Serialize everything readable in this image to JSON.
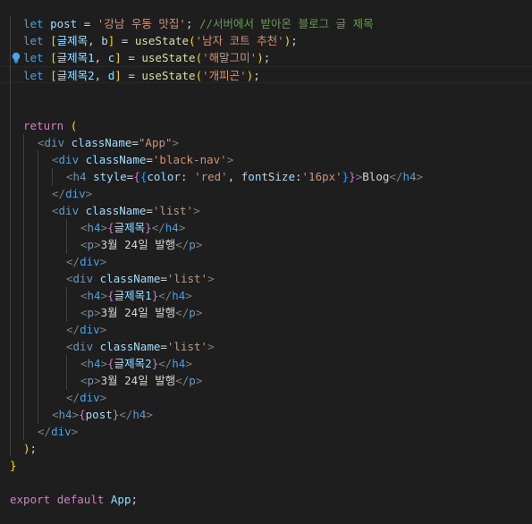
{
  "editor": {
    "lines": [
      {
        "parts": [
          [
            "kw",
            "let"
          ],
          [
            "pl",
            " "
          ],
          [
            "var",
            "post"
          ],
          [
            "pl",
            " = "
          ],
          [
            "str",
            "'강남 우동 맛집'"
          ],
          [
            "pl",
            "; "
          ],
          [
            "cmt",
            "//서버에서 받아온 블로그 글 제목"
          ]
        ]
      },
      {
        "parts": [
          [
            "kw",
            "let"
          ],
          [
            "pl",
            " "
          ],
          [
            "br1",
            "["
          ],
          [
            "var",
            "글제목"
          ],
          [
            "pl",
            ", "
          ],
          [
            "var",
            "b"
          ],
          [
            "br1",
            "]"
          ],
          [
            "pl",
            " = "
          ],
          [
            "fn",
            "useState"
          ],
          [
            "br1",
            "("
          ],
          [
            "str",
            "'남자 코트 추천'"
          ],
          [
            "br1",
            ")"
          ],
          [
            "pl",
            ";"
          ]
        ]
      },
      {
        "parts": [
          [
            "kw",
            "let"
          ],
          [
            "pl",
            " "
          ],
          [
            "br1",
            "["
          ],
          [
            "var",
            "글제목1"
          ],
          [
            "pl",
            ", "
          ],
          [
            "var",
            "c"
          ],
          [
            "br1",
            "]"
          ],
          [
            "pl",
            " = "
          ],
          [
            "fn",
            "useState"
          ],
          [
            "br1",
            "("
          ],
          [
            "str",
            "'해말그미'"
          ],
          [
            "br1",
            ")"
          ],
          [
            "pl",
            ";"
          ]
        ]
      },
      {
        "parts": [
          [
            "kw",
            "let"
          ],
          [
            "pl",
            " "
          ],
          [
            "br1",
            "["
          ],
          [
            "var",
            "글제목2"
          ],
          [
            "pl",
            ", "
          ],
          [
            "var",
            "d"
          ],
          [
            "br1",
            "]"
          ],
          [
            "pl",
            " = "
          ],
          [
            "fn",
            "useState"
          ],
          [
            "br1",
            "("
          ],
          [
            "str",
            "'개피곤'"
          ],
          [
            "br1",
            ")"
          ],
          [
            "pl",
            ";"
          ]
        ]
      },
      {
        "parts": []
      },
      {
        "parts": []
      },
      {
        "parts": [
          [
            "ret",
            "return"
          ],
          [
            "pl",
            " "
          ],
          [
            "br1",
            "("
          ]
        ]
      },
      {
        "parts": [
          [
            "ang",
            "<"
          ],
          [
            "tag",
            "div"
          ],
          [
            "pl",
            " "
          ],
          [
            "attr",
            "className"
          ],
          [
            "pl",
            "="
          ],
          [
            "str",
            "\"App\""
          ],
          [
            "ang",
            ">"
          ]
        ]
      },
      {
        "parts": [
          [
            "ang",
            "<"
          ],
          [
            "tag",
            "div"
          ],
          [
            "pl",
            " "
          ],
          [
            "attr",
            "className"
          ],
          [
            "pl",
            "="
          ],
          [
            "str",
            "'black-nav'"
          ],
          [
            "ang",
            ">"
          ]
        ]
      },
      {
        "parts": [
          [
            "ang",
            "<"
          ],
          [
            "tag",
            "h4"
          ],
          [
            "pl",
            " "
          ],
          [
            "attr",
            "style"
          ],
          [
            "pl",
            "="
          ],
          [
            "br2",
            "{"
          ],
          [
            "br3",
            "{"
          ],
          [
            "attr",
            "color"
          ],
          [
            "pl",
            ": "
          ],
          [
            "str",
            "'red'"
          ],
          [
            "pl",
            ", "
          ],
          [
            "attr",
            "fontSize"
          ],
          [
            "pl",
            ":"
          ],
          [
            "str",
            "'16px'"
          ],
          [
            "br3",
            "}"
          ],
          [
            "br2",
            "}"
          ],
          [
            "ang",
            ">"
          ],
          [
            "pl",
            "Blog"
          ],
          [
            "ang",
            "</"
          ],
          [
            "tag",
            "h4"
          ],
          [
            "ang",
            ">"
          ]
        ]
      },
      {
        "parts": [
          [
            "ang",
            "</"
          ],
          [
            "tag",
            "div"
          ],
          [
            "ang",
            ">"
          ]
        ]
      },
      {
        "parts": [
          [
            "ang",
            "<"
          ],
          [
            "tag",
            "div"
          ],
          [
            "pl",
            " "
          ],
          [
            "attr",
            "className"
          ],
          [
            "pl",
            "="
          ],
          [
            "str",
            "'list'"
          ],
          [
            "ang",
            ">"
          ]
        ]
      },
      {
        "parts": [
          [
            "ang",
            "<"
          ],
          [
            "tag",
            "h4"
          ],
          [
            "ang",
            ">"
          ],
          [
            "br2",
            "{"
          ],
          [
            "var",
            "글제목"
          ],
          [
            "br2",
            "}"
          ],
          [
            "ang",
            "</"
          ],
          [
            "tag",
            "h4"
          ],
          [
            "ang",
            ">"
          ]
        ]
      },
      {
        "parts": [
          [
            "ang",
            "<"
          ],
          [
            "tag",
            "p"
          ],
          [
            "ang",
            ">"
          ],
          [
            "pl",
            "3월 24일 발행"
          ],
          [
            "ang",
            "</"
          ],
          [
            "tag",
            "p"
          ],
          [
            "ang",
            ">"
          ]
        ]
      },
      {
        "parts": [
          [
            "ang",
            "</"
          ],
          [
            "tag",
            "div"
          ],
          [
            "ang",
            ">"
          ]
        ]
      },
      {
        "parts": [
          [
            "ang",
            "<"
          ],
          [
            "tag",
            "div"
          ],
          [
            "pl",
            " "
          ],
          [
            "attr",
            "className"
          ],
          [
            "pl",
            "="
          ],
          [
            "str",
            "'list'"
          ],
          [
            "ang",
            ">"
          ]
        ]
      },
      {
        "parts": [
          [
            "ang",
            "<"
          ],
          [
            "tag",
            "h4"
          ],
          [
            "ang",
            ">"
          ],
          [
            "br2",
            "{"
          ],
          [
            "var",
            "글제목1"
          ],
          [
            "br2",
            "}"
          ],
          [
            "ang",
            "</"
          ],
          [
            "tag",
            "h4"
          ],
          [
            "ang",
            ">"
          ]
        ]
      },
      {
        "parts": [
          [
            "ang",
            "<"
          ],
          [
            "tag",
            "p"
          ],
          [
            "ang",
            ">"
          ],
          [
            "pl",
            "3월 24일 발행"
          ],
          [
            "ang",
            "</"
          ],
          [
            "tag",
            "p"
          ],
          [
            "ang",
            ">"
          ]
        ]
      },
      {
        "parts": [
          [
            "ang",
            "</"
          ],
          [
            "tag",
            "div"
          ],
          [
            "ang",
            ">"
          ]
        ]
      },
      {
        "parts": [
          [
            "ang",
            "<"
          ],
          [
            "tag",
            "div"
          ],
          [
            "pl",
            " "
          ],
          [
            "attr",
            "className"
          ],
          [
            "pl",
            "="
          ],
          [
            "str",
            "'list'"
          ],
          [
            "ang",
            ">"
          ]
        ]
      },
      {
        "parts": [
          [
            "ang",
            "<"
          ],
          [
            "tag",
            "h4"
          ],
          [
            "ang",
            ">"
          ],
          [
            "br2",
            "{"
          ],
          [
            "var",
            "글제목2"
          ],
          [
            "br2",
            "}"
          ],
          [
            "ang",
            "</"
          ],
          [
            "tag",
            "h4"
          ],
          [
            "ang",
            ">"
          ]
        ]
      },
      {
        "parts": [
          [
            "ang",
            "<"
          ],
          [
            "tag",
            "p"
          ],
          [
            "ang",
            ">"
          ],
          [
            "pl",
            "3월 24일 발행"
          ],
          [
            "ang",
            "</"
          ],
          [
            "tag",
            "p"
          ],
          [
            "ang",
            ">"
          ]
        ]
      },
      {
        "parts": [
          [
            "ang",
            "</"
          ],
          [
            "tag",
            "div"
          ],
          [
            "ang",
            ">"
          ]
        ]
      },
      {
        "parts": [
          [
            "ang",
            "<"
          ],
          [
            "tag",
            "h4"
          ],
          [
            "ang",
            ">"
          ],
          [
            "br2",
            "{"
          ],
          [
            "var",
            "post"
          ],
          [
            "br2",
            "}"
          ],
          [
            "ang",
            "</"
          ],
          [
            "tag",
            "h4"
          ],
          [
            "ang",
            ">"
          ]
        ]
      },
      {
        "parts": [
          [
            "ang",
            "</"
          ],
          [
            "tag",
            "div"
          ],
          [
            "ang",
            ">"
          ]
        ]
      },
      {
        "parts": [
          [
            "br1",
            ")"
          ],
          [
            "pl",
            ";"
          ]
        ]
      },
      {
        "parts": [
          [
            "br1",
            "}"
          ]
        ]
      },
      {
        "parts": []
      },
      {
        "parts": [
          [
            "kw2",
            "export"
          ],
          [
            "pl",
            " "
          ],
          [
            "kw2",
            "default"
          ],
          [
            "pl",
            " "
          ],
          [
            "var",
            "App"
          ],
          [
            "pl",
            ";"
          ]
        ]
      }
    ],
    "lightbulb_icon": "lightbulb-icon"
  }
}
